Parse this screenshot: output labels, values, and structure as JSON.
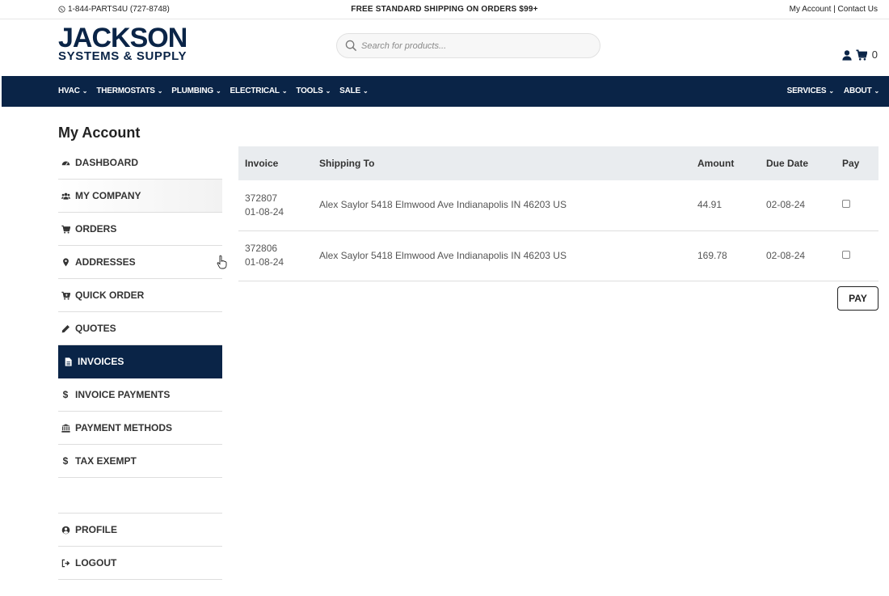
{
  "topbar": {
    "phone": "1-844-PARTS4U (727-8748)",
    "shipping": "FREE STANDARD SHIPPING ON ORDERS $99+",
    "my_account": "My Account",
    "separator": " | ",
    "contact": "Contact Us"
  },
  "header": {
    "logo_line1": "JACKSON",
    "logo_line2": "SYSTEMS & SUPPLY",
    "search_placeholder": "Search for products...",
    "cart_count": "0",
    "icons": [
      "user-icon",
      "cart-icon",
      "search-icon"
    ]
  },
  "nav": {
    "left": [
      "HVAC",
      "THERMOSTATS",
      "PLUMBING",
      "ELECTRICAL",
      "TOOLS",
      "SALE"
    ],
    "right": [
      "SERVICES",
      "ABOUT"
    ]
  },
  "page_title": "My Account",
  "sidebar": {
    "items": [
      {
        "label": "DASHBOARD",
        "icon": "dashboard-icon"
      },
      {
        "label": "MY COMPANY",
        "icon": "users-icon"
      },
      {
        "label": "ORDERS",
        "icon": "cart-icon"
      },
      {
        "label": "ADDRESSES",
        "icon": "map-marker-icon"
      },
      {
        "label": "QUICK ORDER",
        "icon": "cart-plus-icon"
      },
      {
        "label": "QUOTES",
        "icon": "pencil-icon"
      },
      {
        "label": "INVOICES",
        "icon": "file-icon",
        "active": true
      },
      {
        "label": "INVOICE PAYMENTS",
        "icon": "dollar-icon"
      },
      {
        "label": "PAYMENT METHODS",
        "icon": "bank-icon"
      },
      {
        "label": "TAX EXEMPT",
        "icon": "dollar-icon"
      }
    ],
    "bottom": [
      {
        "label": "PROFILE",
        "icon": "user-circle-icon"
      },
      {
        "label": "LOGOUT",
        "icon": "sign-out-icon"
      }
    ]
  },
  "invoices": {
    "columns": [
      "Invoice",
      "Shipping To",
      "Amount",
      "Due Date",
      "Pay"
    ],
    "rows": [
      {
        "invoice": "372807",
        "date": "01-08-24",
        "ship_to": "Alex Saylor 5418 Elmwood Ave Indianapolis IN 46203 US",
        "amount": "44.91",
        "due": "02-08-24",
        "checked": false
      },
      {
        "invoice": "372806",
        "date": "01-08-24",
        "ship_to": "Alex Saylor 5418 Elmwood Ave Indianapolis IN 46203 US",
        "amount": "169.78",
        "due": "02-08-24",
        "checked": false
      }
    ],
    "pay_button": "PAY"
  },
  "colors": {
    "navy": "#0a2447",
    "header_bg": "#e9ecef"
  }
}
